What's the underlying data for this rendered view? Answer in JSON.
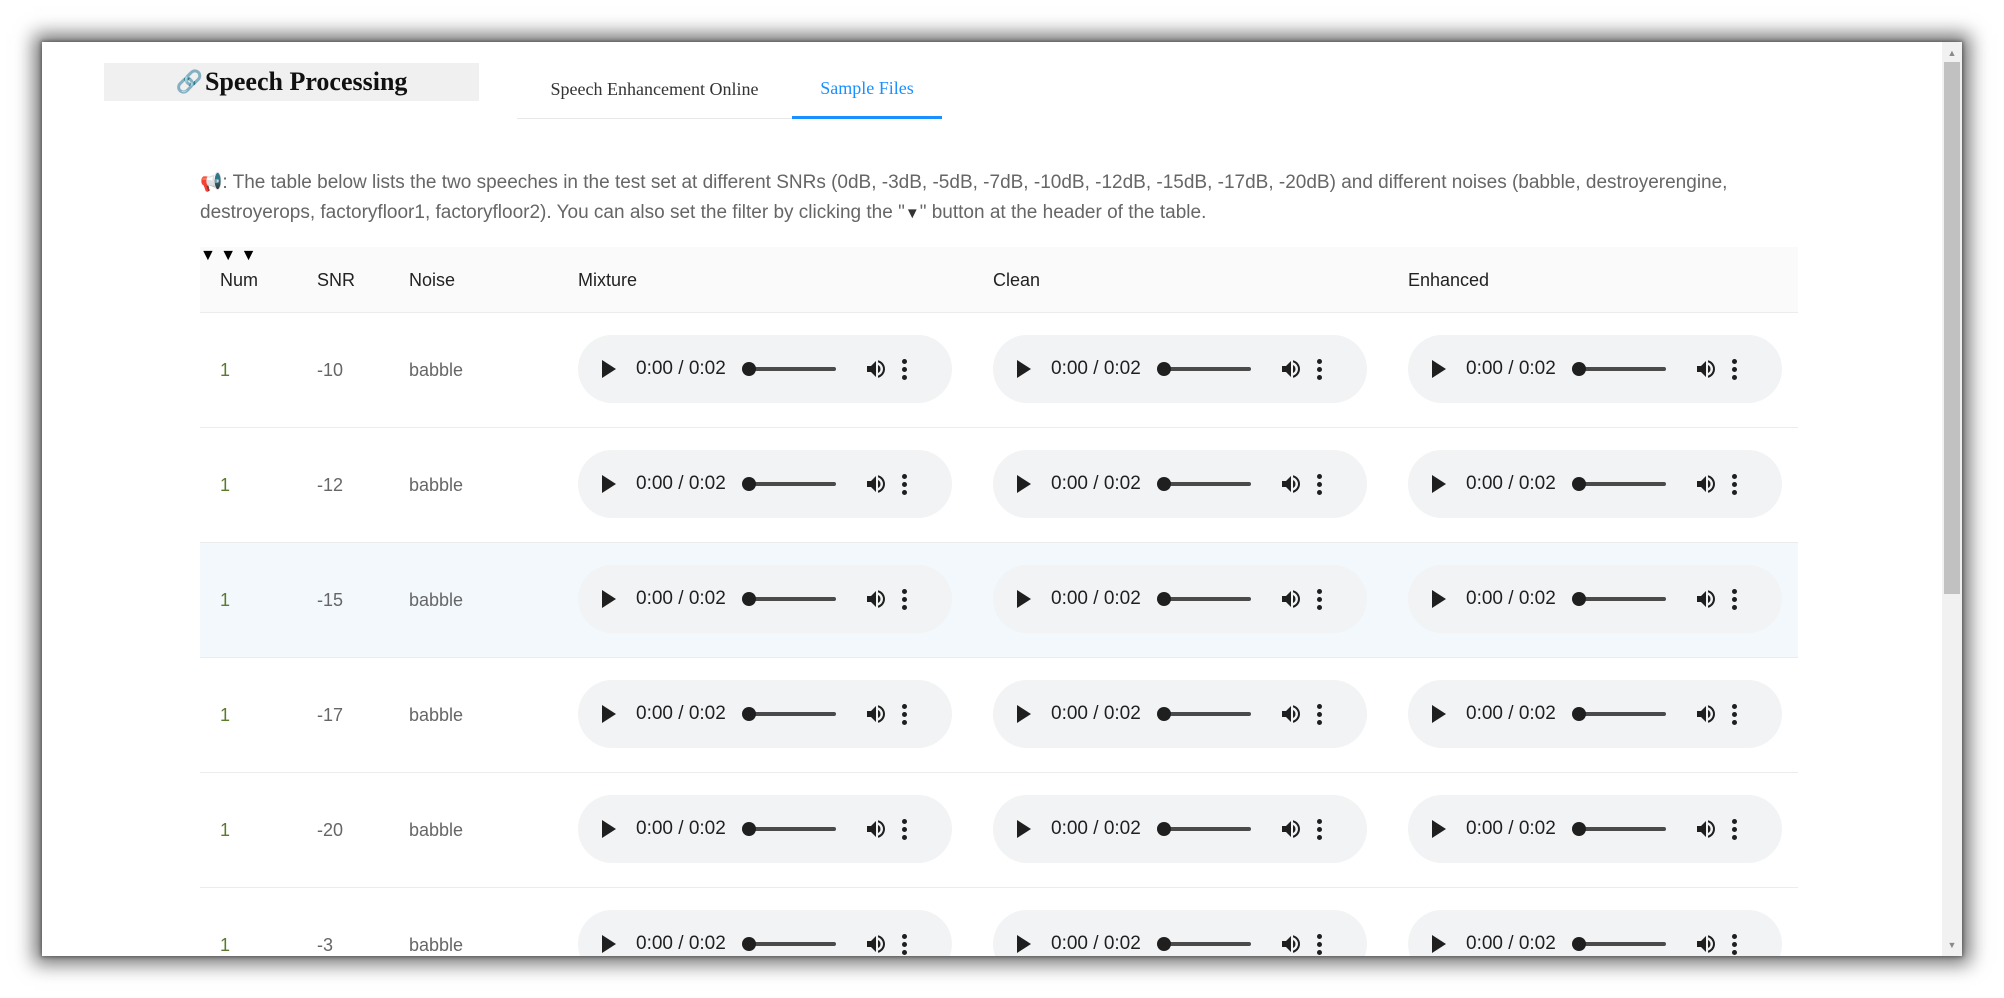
{
  "app": {
    "logo_icon": "🔗",
    "logo_text": "Speech Processing"
  },
  "tabs": [
    {
      "label": "Speech Enhancement Online",
      "active": false
    },
    {
      "label": "Sample Files",
      "active": true
    }
  ],
  "intro": {
    "icon": "megaphone-icon",
    "text_before": ": The table below lists the two speeches in the test set at different SNRs (0dB, -3dB, -5dB, -7dB, -10dB, -12dB, -15dB, -17dB, -20dB) and different noises (babble, destroyerengine, destroyerops, factoryfloor1, factoryfloor2). You can also set the filter by clicking the \"",
    "text_after": "\" button at the header of the table."
  },
  "table": {
    "columns": {
      "num": "Num",
      "snr": "SNR",
      "noise": "Noise",
      "mixture": "Mixture",
      "clean": "Clean",
      "enhanced": "Enhanced"
    },
    "rows": [
      {
        "num": "1",
        "snr": "-10",
        "noise": "babble"
      },
      {
        "num": "1",
        "snr": "-12",
        "noise": "babble"
      },
      {
        "num": "1",
        "snr": "-15",
        "noise": "babble"
      },
      {
        "num": "1",
        "snr": "-17",
        "noise": "babble"
      },
      {
        "num": "1",
        "snr": "-20",
        "noise": "babble"
      },
      {
        "num": "1",
        "snr": "-3",
        "noise": "babble"
      }
    ],
    "highlighted_row": 2,
    "player_time": "0:00 / 0:02"
  },
  "colors": {
    "accent": "#1890ff",
    "row_highlight": "#f2f8fc"
  }
}
